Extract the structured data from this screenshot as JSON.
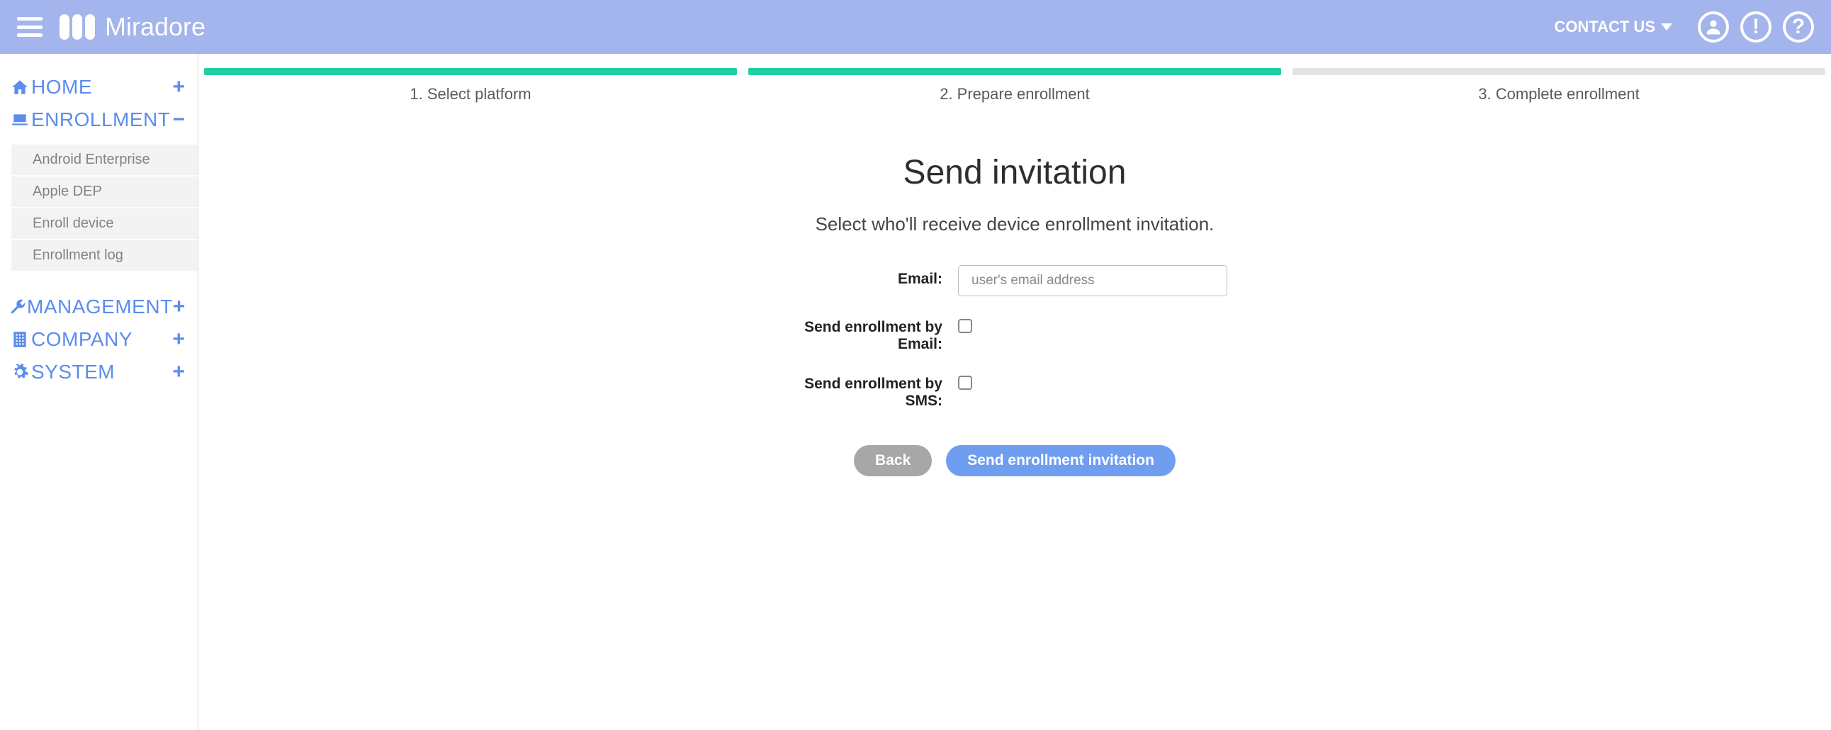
{
  "header": {
    "brand": "Miradore",
    "contact_label": "CONTACT US"
  },
  "sidebar": {
    "items": [
      {
        "label": "HOME",
        "icon": "home",
        "expanded": false
      },
      {
        "label": "ENROLLMENT",
        "icon": "laptop",
        "expanded": true,
        "children": [
          "Android Enterprise",
          "Apple DEP",
          "Enroll device",
          "Enrollment log"
        ]
      },
      {
        "label": "MANAGEMENT",
        "icon": "wrench",
        "expanded": false
      },
      {
        "label": "COMPANY",
        "icon": "building",
        "expanded": false
      },
      {
        "label": "SYSTEM",
        "icon": "gear",
        "expanded": false
      }
    ]
  },
  "wizard": {
    "steps": [
      {
        "label": "1. Select platform",
        "done": true
      },
      {
        "label": "2. Prepare enrollment",
        "done": true
      },
      {
        "label": "3. Complete enrollment",
        "done": false
      }
    ]
  },
  "page": {
    "title": "Send invitation",
    "subtitle": "Select who'll receive device enrollment invitation.",
    "email_label": "Email:",
    "email_placeholder": "user's email address",
    "email_value": "",
    "send_email_label": "Send enrollment by Email:",
    "send_email_checked": false,
    "send_sms_label": "Send enrollment by SMS:",
    "send_sms_checked": false,
    "back_label": "Back",
    "submit_label": "Send enrollment invitation"
  },
  "colors": {
    "header_bg": "#a4b4ec",
    "accent": "#5b8def",
    "step_done": "#20cfa3",
    "btn_primary": "#6f9df0"
  }
}
